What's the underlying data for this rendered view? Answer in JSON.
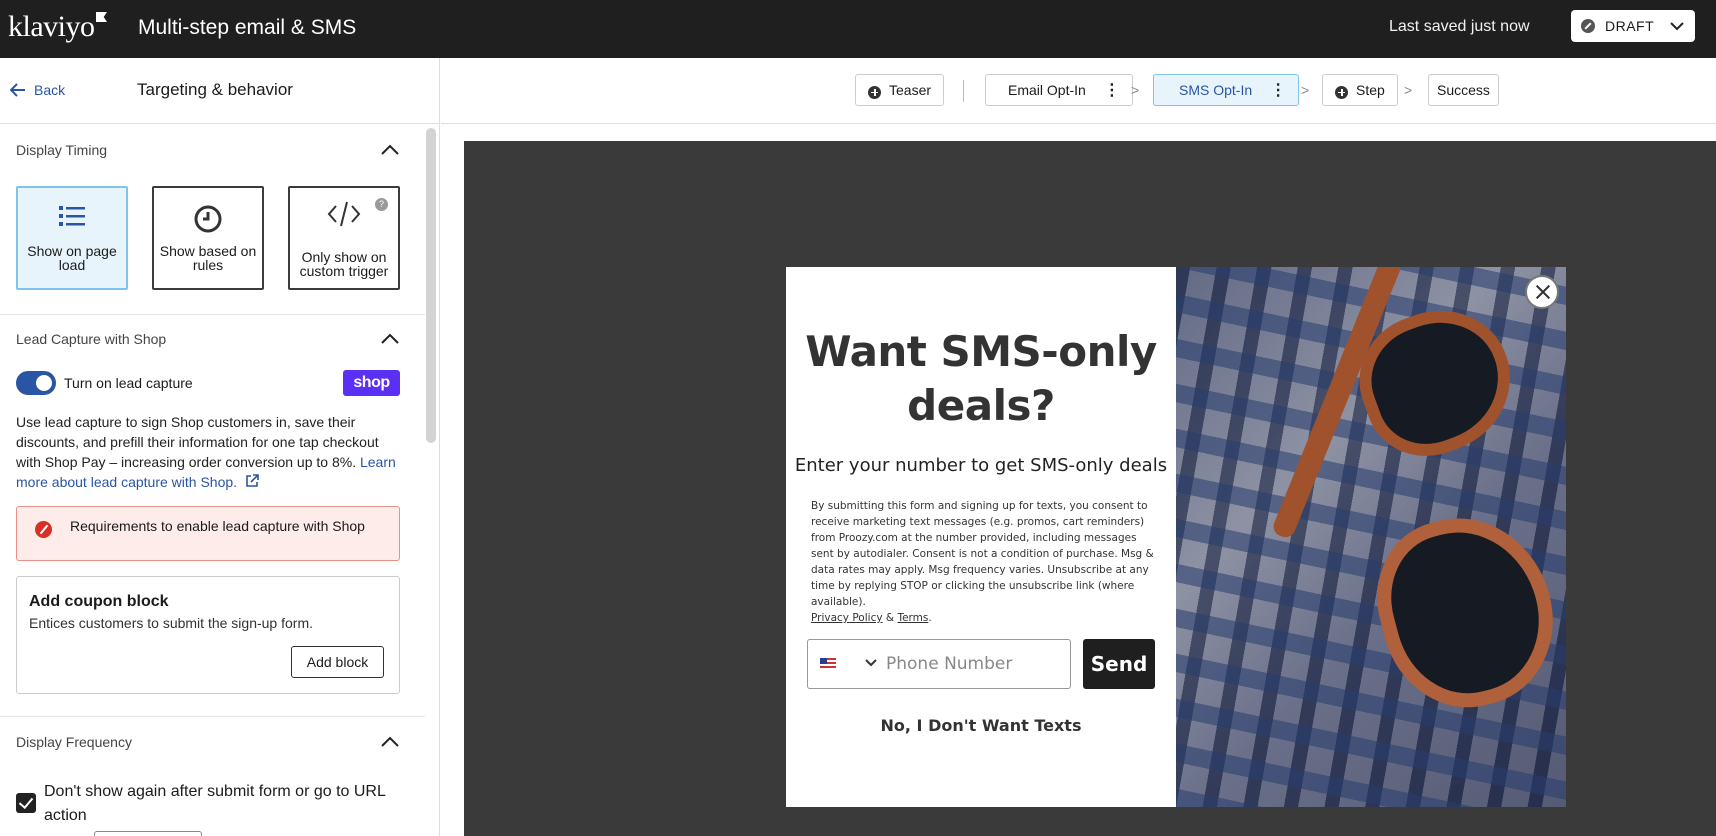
{
  "topbar": {
    "logo": "klaviyo",
    "title": "Multi-step email & SMS",
    "saved_status": "Last saved just now",
    "draft_label": "DRAFT"
  },
  "left_panel": {
    "back_label": "Back",
    "title": "Targeting & behavior",
    "display_timing": {
      "heading": "Display Timing",
      "options": [
        {
          "label": "Show on page load",
          "selected": true
        },
        {
          "label": "Show based on rules",
          "selected": false
        },
        {
          "label": "Only show on custom trigger",
          "selected": false
        }
      ],
      "help_glyph": "?"
    },
    "lead_capture": {
      "heading": "Lead Capture with Shop",
      "toggle_label": "Turn on lead capture",
      "toggle_on": true,
      "badge": "shop",
      "description": "Use lead capture to sign Shop customers in, save their discounts, and prefill their information for one tap checkout with Shop Pay – increasing order conversion up to 8%.",
      "learn_more": "Learn more about lead capture with Shop.",
      "warning": "Requirements to enable lead capture with Shop"
    },
    "coupon": {
      "title": "Add coupon block",
      "description": "Entices customers to submit the sign-up form.",
      "button": "Add block"
    },
    "display_frequency": {
      "heading": "Display Frequency",
      "checkbox_label": "Don't show again after submit form or go to URL action",
      "checked": true
    }
  },
  "steps": {
    "items": [
      {
        "label": "Teaser"
      },
      {
        "label": "Email Opt-In"
      },
      {
        "label": "SMS Opt-In"
      },
      {
        "label": "Step"
      },
      {
        "label": "Success"
      }
    ],
    "active_index": 2
  },
  "popup": {
    "headline_line1": "Want SMS-only",
    "headline_line2": "deals?",
    "subheading": "Enter your number to get SMS-only deals",
    "legal_text": "By submitting this form and signing up for texts, you consent to receive marketing text messages (e.g. promos, cart reminders) from Proozy.com at the number provided, including messages sent by autodialer. Consent is not a condition of purchase. Msg & data rates may apply. Msg frequency varies. Unsubscribe at any time by replying STOP or clicking the unsubscribe link (where available).",
    "privacy_link": "Privacy Policy",
    "ampersand": "&",
    "terms_link": "Terms",
    "phone_placeholder": "Phone Number",
    "send_label": "Send",
    "decline_label": "No, I Don't Want Texts"
  },
  "colors": {
    "accent_blue": "#2a55a4",
    "selected_bg": "#e7f4fc",
    "shop_purple": "#5a31f4",
    "canvas_bg": "#3a3a3b"
  }
}
